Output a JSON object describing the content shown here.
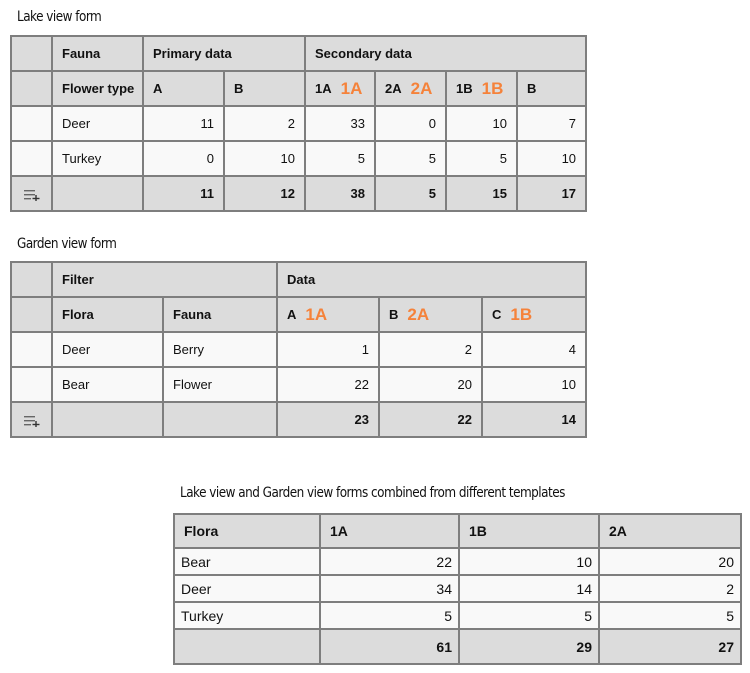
{
  "lake": {
    "title": "Lake view form",
    "header_row1": {
      "fauna": "Fauna",
      "primary": "Primary data",
      "secondary": "Secondary data"
    },
    "header_row2": {
      "flower_type": "Flower type",
      "columns": [
        {
          "label": "A",
          "tag": ""
        },
        {
          "label": "B",
          "tag": ""
        },
        {
          "label": "1A",
          "tag": "1A"
        },
        {
          "label": "2A",
          "tag": "2A"
        },
        {
          "label": "1B",
          "tag": "1B"
        },
        {
          "label": "B",
          "tag": ""
        }
      ]
    },
    "rows": [
      {
        "name": "Deer",
        "values": [
          "11",
          "2",
          "33",
          "0",
          "10",
          "7"
        ]
      },
      {
        "name": "Turkey",
        "values": [
          "0",
          "10",
          "5",
          "5",
          "5",
          "10"
        ]
      }
    ],
    "totals": [
      "11",
      "12",
      "38",
      "5",
      "15",
      "17"
    ],
    "add_row_icon": "playlist-add-icon"
  },
  "garden": {
    "title": "Garden view form",
    "header_row1": {
      "filter": "Filter",
      "data": "Data"
    },
    "header_row2": {
      "flora": "Flora",
      "fauna": "Fauna",
      "columns": [
        {
          "label": "A",
          "tag": "1A"
        },
        {
          "label": "B",
          "tag": "2A"
        },
        {
          "label": "C",
          "tag": "1B"
        }
      ]
    },
    "rows": [
      {
        "flora": "Deer",
        "fauna": "Berry",
        "values": [
          "1",
          "2",
          "4"
        ]
      },
      {
        "flora": "Bear",
        "fauna": "Flower",
        "values": [
          "22",
          "20",
          "10"
        ]
      }
    ],
    "totals": [
      "23",
      "22",
      "14"
    ],
    "add_row_icon": "playlist-add-icon"
  },
  "combined": {
    "title": "Lake view and Garden view forms combined from different templates",
    "headers": [
      "Flora",
      "1A",
      "1B",
      "2A"
    ],
    "rows": [
      {
        "name": "Bear",
        "values": [
          "22",
          "10",
          "20"
        ]
      },
      {
        "name": "Deer",
        "values": [
          "34",
          "14",
          "2"
        ]
      },
      {
        "name": "Turkey",
        "values": [
          "5",
          "5",
          "5"
        ]
      }
    ],
    "totals": [
      "61",
      "29",
      "27"
    ]
  },
  "colors": {
    "tag_accent": "#f5823a",
    "header_bg": "#dcdcdc",
    "cell_bg": "#f9f9f9",
    "border": "#7e7e7e"
  }
}
